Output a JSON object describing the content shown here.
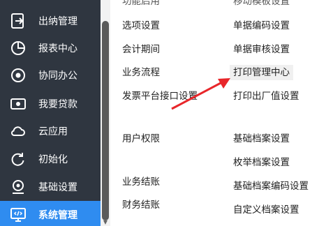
{
  "sidebar": {
    "items": [
      {
        "label": "出纳管理",
        "icon": "cashier-icon"
      },
      {
        "label": "报表中心",
        "icon": "pie-chart-icon"
      },
      {
        "label": "协同办公",
        "icon": "collaboration-icon"
      },
      {
        "label": "我要贷款",
        "icon": "money-icon"
      },
      {
        "label": "云应用",
        "icon": "cloud-icon"
      },
      {
        "label": "初始化",
        "icon": "refresh-icon"
      },
      {
        "label": "基础设置",
        "icon": "settings-icon"
      },
      {
        "label": "系统管理",
        "icon": "monitor-code-icon"
      }
    ],
    "active_color": "#2f8cf0"
  },
  "menu": {
    "col1": {
      "top_partial": "功能启用",
      "items": [
        "选项设置",
        "会计期间",
        "业务流程",
        "发票平台接口设置",
        "用户权限",
        "业务结账",
        "财务结账"
      ]
    },
    "col2": {
      "top_partial": "移动模板设置",
      "items": [
        "单据编码设置",
        "单据审核设置",
        "打印管理中心",
        "打印出厂值设置",
        "基础档案设置",
        "枚举档案设置",
        "基础档案编码设置",
        "自定义档案设置"
      ]
    },
    "highlighted": "打印管理中心"
  },
  "annotation": {
    "arrow_color": "#e8262a"
  }
}
